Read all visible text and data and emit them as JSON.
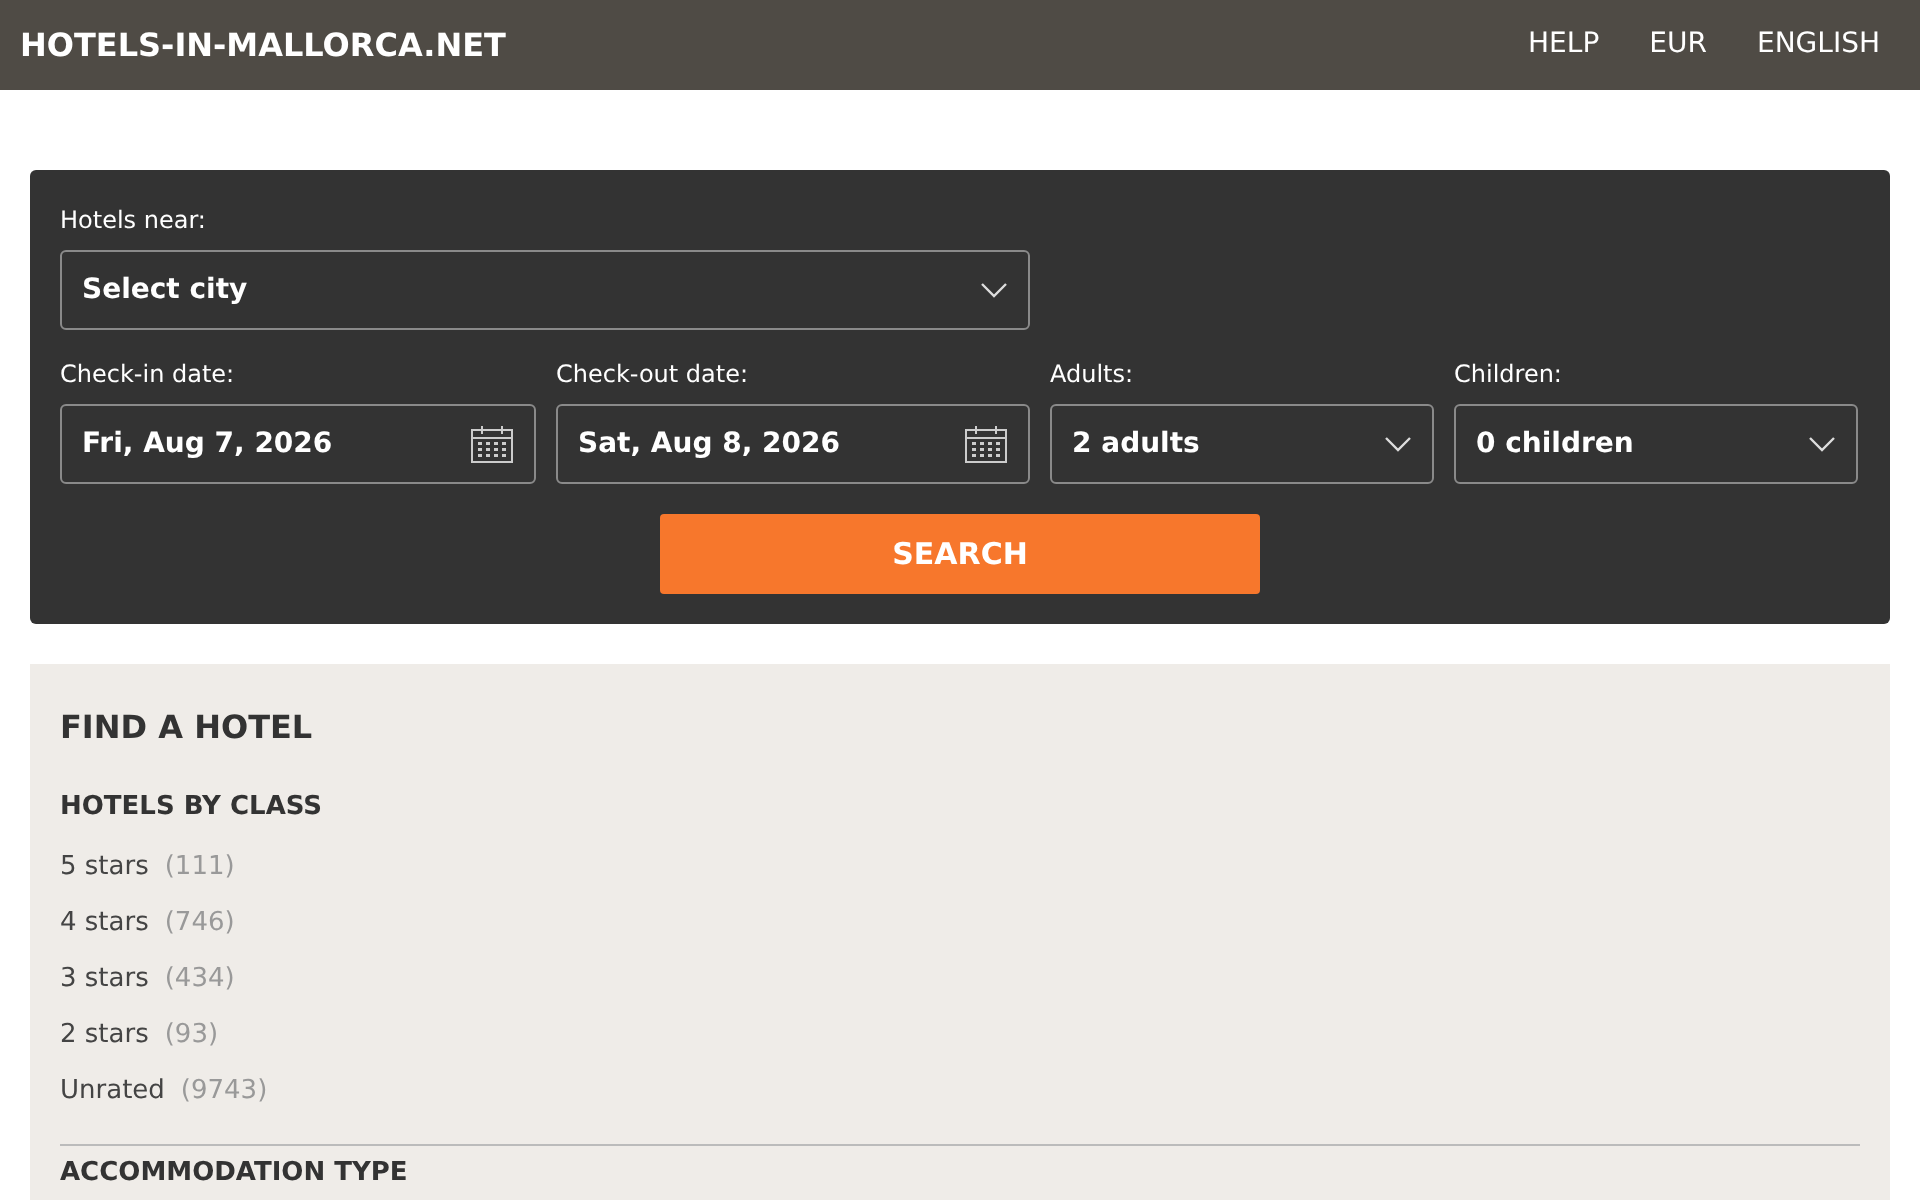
{
  "header": {
    "logo": "HOTELS-IN-MALLORCA.NET",
    "links": [
      "HELP",
      "EUR",
      "ENGLISH"
    ]
  },
  "search_form": {
    "city_label": "Hotels near:",
    "city_value": "Select city",
    "fields": [
      {
        "label": "Check-in date:",
        "value": "Fri, Aug 7, 2026",
        "kind": "date"
      },
      {
        "label": "Check-out date:",
        "value": "Sat, Aug 8, 2026",
        "kind": "date"
      },
      {
        "label": "Adults:",
        "value": "2 adults",
        "kind": "select"
      },
      {
        "label": "Children:",
        "value": "0 children",
        "kind": "select"
      }
    ],
    "button": "SEARCH"
  },
  "find_hotel": {
    "title": "FIND A HOTEL",
    "section": "HOTELS BY CLASS",
    "items": [
      {
        "label": "5 stars",
        "count": "(111)"
      },
      {
        "label": "4 stars",
        "count": "(746)"
      },
      {
        "label": "3 stars",
        "count": "(434)"
      },
      {
        "label": "2 stars",
        "count": "(93)"
      },
      {
        "label": "Unrated",
        "count": "(9743)"
      }
    ],
    "next_section": "ACCOMMODATION TYPE"
  }
}
